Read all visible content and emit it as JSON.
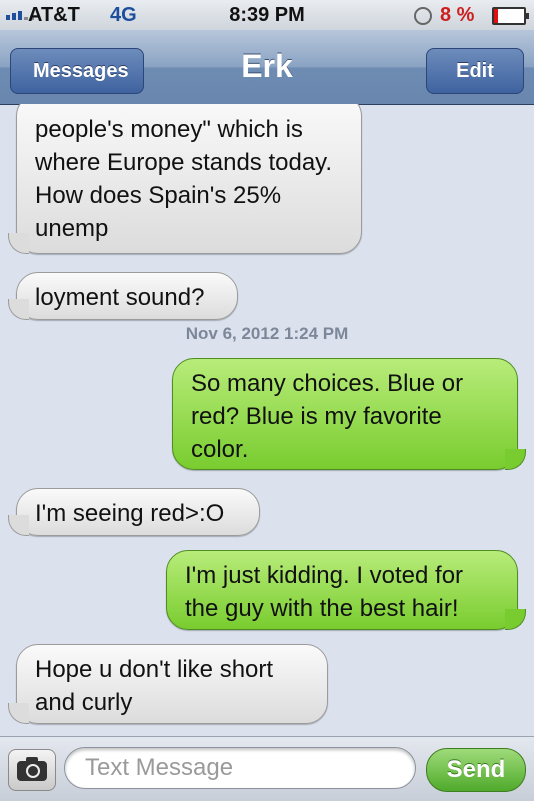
{
  "status_bar": {
    "carrier": "AT&T",
    "network": "4G",
    "time": "8:39 PM",
    "battery_percent": "8 %"
  },
  "nav": {
    "back_label": "Messages",
    "title": "Erk",
    "edit_label": "Edit"
  },
  "messages": [
    {
      "side": "in",
      "text": "people's money\" which is where Europe stands today. How does Spain's 25% unemp"
    },
    {
      "side": "in",
      "text": "loyment sound?"
    },
    {
      "side": "out",
      "text": "So many choices. Blue or red?  Blue is my favorite color."
    },
    {
      "side": "in",
      "text": "I'm seeing red>:O"
    },
    {
      "side": "out",
      "text": "I'm just kidding. I voted for the guy with the best hair!"
    },
    {
      "side": "in",
      "text": "Hope u don't like short and curly"
    }
  ],
  "timestamp": "Nov 6, 2012 1:24 PM",
  "composer": {
    "placeholder": "Text Message",
    "send_label": "Send"
  },
  "icons": [
    "signal-icon",
    "lock-rotation-icon",
    "battery-icon",
    "camera-icon"
  ],
  "colors": {
    "incoming_bubble": "#e6e6e6",
    "outgoing_bubble": "#8ad544",
    "nav_bar": "#6f8cb3",
    "background": "#dbe2ed",
    "battery_low": "#cc1f1f"
  }
}
